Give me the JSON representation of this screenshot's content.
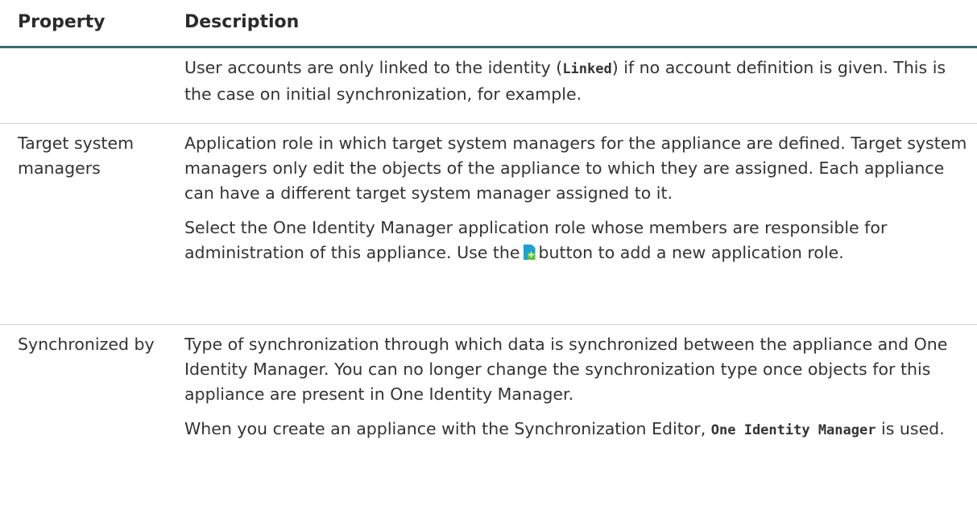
{
  "table": {
    "headers": {
      "property": "Property",
      "description": "Description"
    },
    "row0": {
      "p1_prefix": "User accounts are only linked to the identity (",
      "p1_code": "Linked",
      "p1_suffix": ") if no account definition is given. This is the case on initial synchronization, for example."
    },
    "row1": {
      "property": "Target system managers",
      "p1": "Application role in which target system managers for the appliance are defined. Target system managers only edit the objects of the appliance to which they are assigned. Each appliance can have a different target system manager assigned to it.",
      "p2_prefix": "Select the One Identity Manager application role whose members are responsible for administration of this appliance. Use the",
      "p2_icon": "add-document-icon",
      "p2_suffix": "button to add a new application role."
    },
    "row2": {
      "property": "Synchronized by",
      "p1": "Type of synchronization through which data is synchronized between the appliance and One Identity Manager. You can no longer change the synchronization type once objects for this appliance are present in One Identity Manager.",
      "p2_prefix": "When you create an appliance with the Synchronization Editor,",
      "p2_code": "One Identity Manager",
      "p2_suffix": "is used."
    }
  },
  "colors": {
    "header_rule": "#3a6b76",
    "row_rule": "#d4d4d4",
    "text": "#333333",
    "icon_blue": "#1f9fd4",
    "icon_green": "#5cc23c"
  }
}
